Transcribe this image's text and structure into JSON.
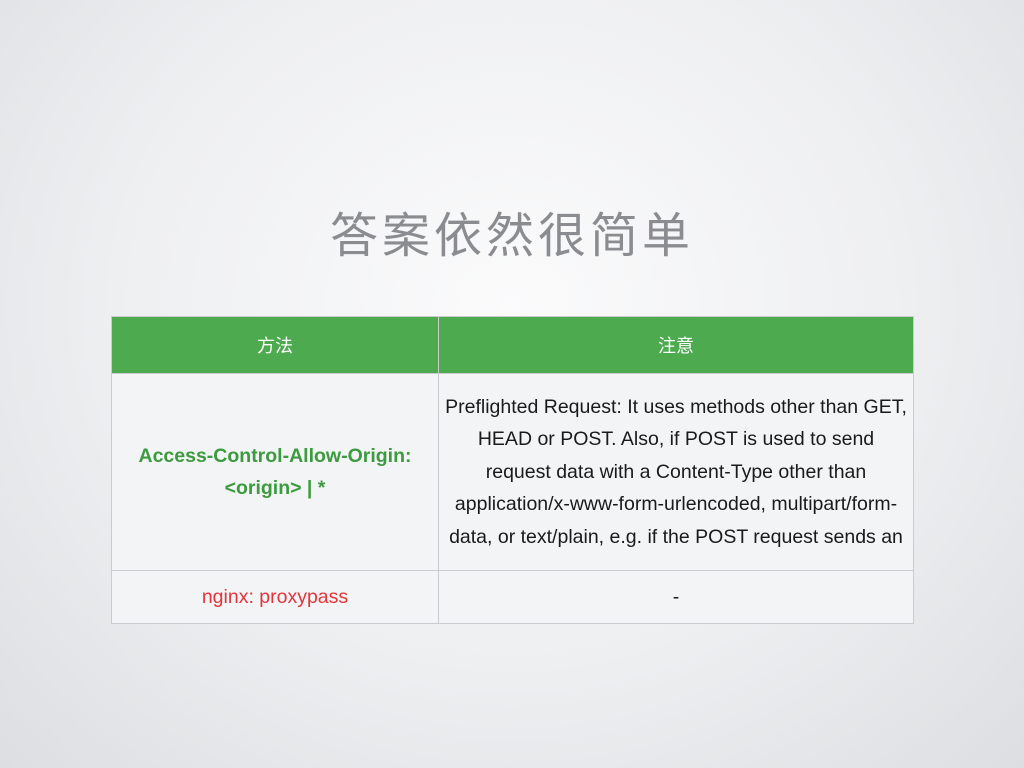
{
  "slide": {
    "title": "答案依然很简单"
  },
  "table": {
    "headers": {
      "method": "方法",
      "note": "注意"
    },
    "rows": [
      {
        "method": "Access-Control-Allow-Origin: <origin> | *",
        "method_color": "#3c9a3f",
        "note": "Preflighted Request: It uses methods other than GET, HEAD or POST.  Also, if POST is used to send request data with a Content-Type other than application/x-www-form-urlencoded, multipart/form-data, or text/plain, e.g. if the POST request sends an"
      },
      {
        "method": "nginx: proxypass",
        "method_color": "#e2343b",
        "note": "-"
      }
    ],
    "header_color": "#4daa4f"
  }
}
